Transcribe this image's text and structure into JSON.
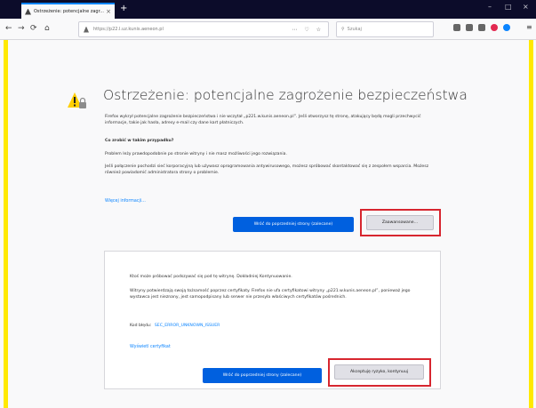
{
  "browser": {
    "tab_title": "Ostrzeżenie: potencjalne zagr...",
    "tab_close": "×",
    "new_tab": "+",
    "window_controls": {
      "minimize": "–",
      "maximize": "□",
      "close": "×"
    },
    "url": "https://p22.l.uz.kunis.aeneon.pl",
    "url_actions": "⋯ ♡ ☆",
    "search_placeholder": "Szukaj",
    "nav": {
      "back": "←",
      "forward": "→",
      "reload": "⟳",
      "home": "⌂"
    },
    "menu_icon": "≡"
  },
  "page": {
    "title": "Ostrzeżenie: potencjalne zagrożenie bezpieczeństwa",
    "intro": "Firefox wykrył potencjalne zagrożenie bezpieczeństwa i nie wczytał „p221.w.kunis.aeneon.pl”. Jeśli otworzysz tę stronę, atakujący będą mogli przechwycić informacje, takie jak hasła, adresy e-mail czy dane kart płatniczych.",
    "what_heading": "Co zrobić w takim przypadku?",
    "what_text": "Problem leży prawdopodobnie po stronie witryny i nie masz możliwości jego rozwiązania.",
    "network_text": "Jeśli połączenie pochodzi sieć korporacyjną lub używasz oprogramowania antywirusowego, możesz spróbować skontaktować się z zespołem wsparcia. Możesz również powiadomić administratora strony o problemie.",
    "more_info_link": "Więcej informacji…",
    "go_back_button": "Wróć do poprzedniej strony (zalecane)",
    "advanced_button": "Zaawansowane…",
    "advanced": {
      "text1": "Ktoś może próbować podszywać się pod tę witrynę. Dokładniej Kontynuowanie.",
      "text2": "Witryny potwierdzają swoją tożsamość poprzez certyfikaty. Firefox nie ufa certyfikatowi witryny „p221.w.kunis.aeneon.pl”, ponieważ jego wystawca jest nieznany, jest samopodpisany lub serwer nie przesyła właściwych certyfikatów pośrednich.",
      "error_code_label": "Kod błędu:",
      "error_code": "SEC_ERROR_UNKNOWN_ISSUER",
      "view_cert_link": "Wyświetl certyfikat",
      "go_back_button": "Wróć do poprzedniej strony (zalecane)",
      "accept_button": "Akceptuję ryzyko, kontynuuj"
    }
  },
  "colors": {
    "accent_blue": "#0060df",
    "highlight_red": "#d7262f",
    "rail_yellow": "#ffe900",
    "tab_bar": "#0c0c2a"
  }
}
